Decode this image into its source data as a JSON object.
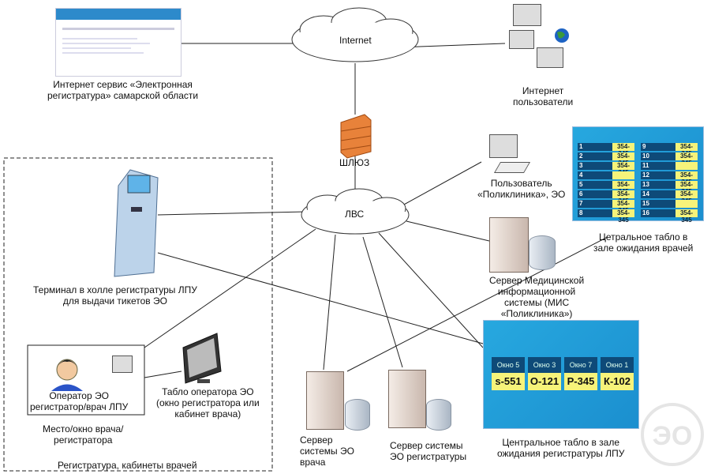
{
  "nodes": {
    "internet": "Internet",
    "lan": "ЛВС",
    "gateway": "ШЛЮЗ",
    "web_service": "Интернет сервис «Электронная\nрегистратура» самарской области",
    "internet_users": "Интернет\nпользователи",
    "clinic_user": "Пользователь\n«Поликлиника», ЭО",
    "doctors_board_caption": "Цетральное табло в\nзале ожидания врачей",
    "mis_server": "Сервер Медицинской\nинформационной\nсистемы (МИС\n«Поликлиника»)",
    "terminal": "Терминал в холле регистратуры ЛПУ\nдля выдачи тикетов ЭО",
    "operator": "Оператор ЭО\nрегистратор/врач ЛПУ",
    "operator_board": "Табло оператора ЭО\n(окно регистратора или\nкабинет врача)",
    "workplace": "Место/окно врача/\nрегистратора",
    "registry_zone": "Регистратура, кабинеты врачей",
    "doctor_server": "Сервер\nсистемы ЭО\nврача",
    "registry_server": "Сервер системы\nЭО регистратуры",
    "registry_board_caption": "Центральное табло в зале\nожидания регистратуры ЛПУ"
  },
  "doctors_board": {
    "rows": [
      {
        "num": "1",
        "code": "354-345"
      },
      {
        "num": "2",
        "code": "354-345"
      },
      {
        "num": "3",
        "code": "354-345"
      },
      {
        "num": "4",
        "code": ""
      },
      {
        "num": "5",
        "code": "354-345"
      },
      {
        "num": "6",
        "code": "354-345"
      },
      {
        "num": "7",
        "code": "354-345"
      },
      {
        "num": "8",
        "code": "354-345"
      },
      {
        "num": "9",
        "code": "354-345"
      },
      {
        "num": "10",
        "code": "354-345"
      },
      {
        "num": "11",
        "code": ""
      },
      {
        "num": "12",
        "code": "354-345"
      },
      {
        "num": "13",
        "code": "354-345"
      },
      {
        "num": "14",
        "code": "354-345"
      },
      {
        "num": "15",
        "code": ""
      },
      {
        "num": "16",
        "code": "354-345"
      }
    ]
  },
  "registry_board": {
    "windows": [
      {
        "label": "Окно 5",
        "ticket": "s-551"
      },
      {
        "label": "Окно 3",
        "ticket": "О-121"
      },
      {
        "label": "Окно 7",
        "ticket": "Р-345"
      },
      {
        "label": "Окно 1",
        "ticket": "К-102"
      }
    ]
  },
  "watermark": "ЭО",
  "colors": {
    "board": "#1b9ad6",
    "ticket": "#f6f37a",
    "firewall": "#e8823a"
  }
}
